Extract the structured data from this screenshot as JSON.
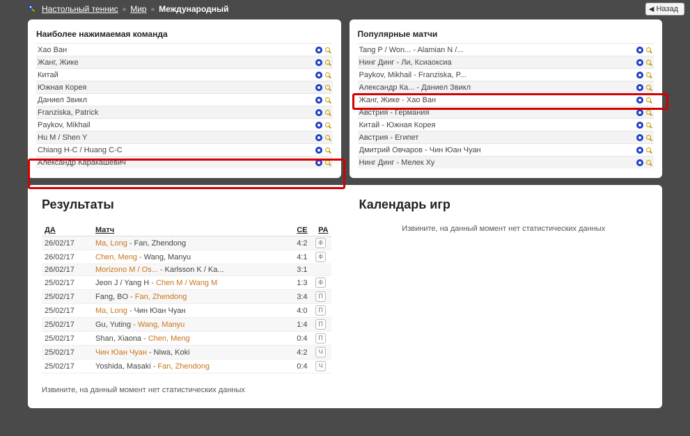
{
  "breadcrumb": {
    "sport": "Настольный теннис",
    "region": "Мир",
    "league": "Международный",
    "sep": "»"
  },
  "back_label": "Назад",
  "panels": {
    "teams_title": "Наиболее нажимаемая команда",
    "teams": [
      "Хао Ван",
      "Жанг, Жике",
      "Китай",
      "Южная Корея",
      "Даниел Звикл",
      "Franziska, Patrick",
      "Paykov, Mikhail",
      "Hu M / Shen Y",
      "Chiang H-C / Huang C-C",
      "Александр Каракашевич"
    ],
    "matches_title": "Популярные матчи",
    "matches": [
      "Tang P / Won... - Alamian N /...",
      "Нинг Динг - Ли, Ксиаоксиа",
      "Paykov, Mikhail - Franziska, P...",
      "Александр Ка... - Даниел Звикл",
      "Жанг, Жике - Хао Ван",
      "Австрия - Германия",
      "Китай - Южная Корея",
      "Австрия - Египет",
      "Дмитрий Овчаров - Чин Юан Чуан",
      "Нинг Динг - Мелек Ху"
    ]
  },
  "results": {
    "title": "Результаты",
    "headers": {
      "date": "ДА",
      "match": "Матч",
      "score": "СЕ",
      "ra": "РА"
    },
    "rows": [
      {
        "date": "26/02/17",
        "a": "Ma, Long",
        "b": "Fan, Zhendong",
        "aw": true,
        "score": "4:2",
        "ra": "Ф"
      },
      {
        "date": "26/02/17",
        "a": "Chen, Meng",
        "b": "Wang, Manyu",
        "aw": true,
        "score": "4:1",
        "ra": "Ф"
      },
      {
        "date": "26/02/17",
        "a": "Morizono M / Os...",
        "b": "Karlsson K / Ka...",
        "aw": true,
        "score": "3:1",
        "ra": ""
      },
      {
        "date": "25/02/17",
        "a": "Jeon J / Yang H",
        "b": "Chen M / Wang M",
        "aw": false,
        "score": "1:3",
        "ra": "Ф"
      },
      {
        "date": "25/02/17",
        "a": "Fang, BO",
        "b": "Fan, Zhendong",
        "aw": false,
        "score": "3:4",
        "ra": "П"
      },
      {
        "date": "25/02/17",
        "a": "Ma, Long",
        "b": "Чин Юан Чуан",
        "aw": true,
        "score": "4:0",
        "ra": "П"
      },
      {
        "date": "25/02/17",
        "a": "Gu, Yuting",
        "b": "Wang, Manyu",
        "aw": false,
        "score": "1:4",
        "ra": "П"
      },
      {
        "date": "25/02/17",
        "a": "Shan, Xiaona",
        "b": "Chen, Meng",
        "aw": false,
        "score": "0:4",
        "ra": "П"
      },
      {
        "date": "25/02/17",
        "a": "Чин Юан Чуан",
        "b": "Niwa, Koki",
        "aw": true,
        "score": "4:2",
        "ra": "Ч"
      },
      {
        "date": "25/02/17",
        "a": "Yoshida, Masaki",
        "b": "Fan, Zhendong",
        "aw": false,
        "score": "0:4",
        "ra": "Ч"
      }
    ],
    "no_stats": "Извините, на данный момент нет статистических данных"
  },
  "calendar": {
    "title": "Календарь игр",
    "no_stats": "Извините, на данный момент нет статистических данных"
  }
}
